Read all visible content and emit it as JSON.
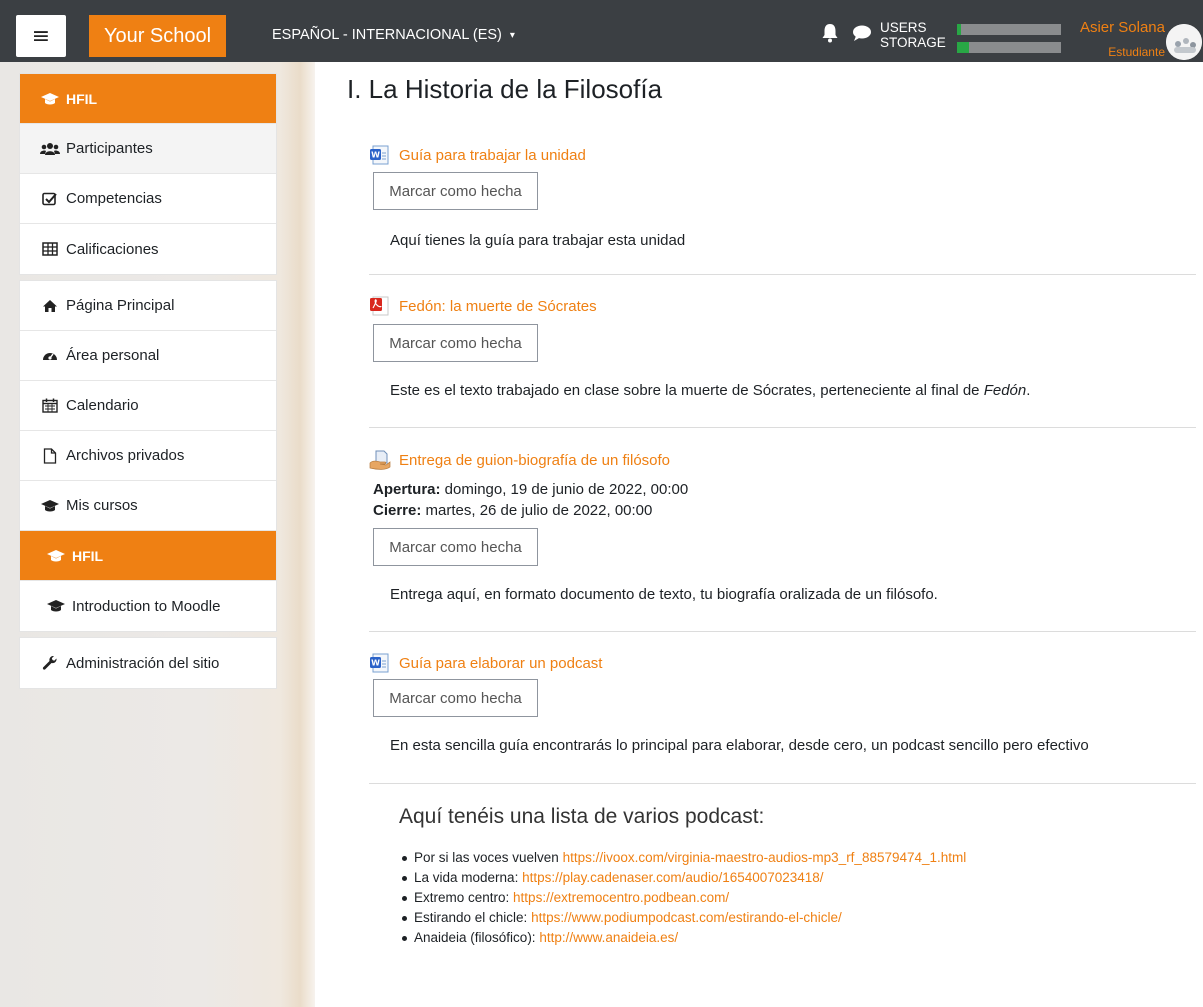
{
  "colors": {
    "accent": "#ef8013",
    "navbar": "#3b3f43",
    "progress": "#28a745"
  },
  "navbar": {
    "menu_icon": "hamburger-icon",
    "menu_glyph": "≡",
    "brand": "Your School",
    "language": "ESPAÑOL - INTERNACIONAL (ES)",
    "language_caret": "▾",
    "users_label": "USERS",
    "storage_label": "STORAGE",
    "users_usage_percent": 4,
    "storage_usage_percent": 12,
    "user_name": "Asier Solana",
    "user_role": "Estudiante"
  },
  "sidebar": {
    "course_group": [
      {
        "label": "HFIL",
        "icon": "graduation-cap-icon"
      },
      {
        "label": "Participantes",
        "icon": "users-icon"
      },
      {
        "label": "Competencias",
        "icon": "checkbox-icon"
      },
      {
        "label": "Calificaciones",
        "icon": "table-icon"
      }
    ],
    "site_group": [
      {
        "label": "Página Principal",
        "icon": "home-icon"
      },
      {
        "label": "Área personal",
        "icon": "dashboard-icon"
      },
      {
        "label": "Calendario",
        "icon": "calendar-icon"
      },
      {
        "label": "Archivos privados",
        "icon": "file-icon"
      },
      {
        "label": "Mis cursos",
        "icon": "graduation-cap-icon"
      },
      {
        "label": "HFIL",
        "icon": "graduation-cap-icon"
      },
      {
        "label": "Introduction to Moodle",
        "icon": "graduation-cap-icon"
      }
    ],
    "admin": {
      "label": "Administración del sitio",
      "icon": "wrench-icon"
    }
  },
  "main": {
    "section_title": "I. La Historia de la Filosofía",
    "mark_done_label": "Marcar como hecha",
    "activities": [
      {
        "title": "Guía para trabajar la unidad",
        "icon": "word-document-icon",
        "description": "Aquí tienes la guía para trabajar esta unidad"
      },
      {
        "title": "Fedón: la muerte de Sócrates",
        "icon": "pdf-document-icon",
        "description": "Este es el texto trabajado en clase sobre la muerte de Sócrates, perteneciente al final de ",
        "description_italic": "Fedón",
        "description_end": "."
      },
      {
        "title": "Entrega de guion-biografía de un filósofo",
        "icon": "assignment-icon",
        "opening_label": "Apertura:",
        "opening_value": " domingo, 19 de junio de 2022, 00:00",
        "closing_label": "Cierre:",
        "closing_value": " martes, 26 de julio de 2022, 00:00",
        "description": "Entrega aquí, en formato documento de texto, tu biografía oralizada de un filósofo."
      },
      {
        "title": "Guía para elaborar un podcast",
        "icon": "word-document-icon",
        "description": "En esta sencilla guía encontrarás lo principal para elaborar, desde cero, un podcast sencillo pero efectivo"
      }
    ],
    "podcast_heading": "Aquí tenéis una lista de varios podcast:",
    "podcasts": [
      {
        "name": "Por si las voces vuelven ",
        "url": "https://ivoox.com/virginia-maestro-audios-mp3_rf_88579474_1.html"
      },
      {
        "name": "La vida moderna: ",
        "url": "https://play.cadenaser.com/audio/1654007023418/"
      },
      {
        "name": "Extremo centro: ",
        "url": "https://extremocentro.podbean.com/"
      },
      {
        "name": "Estirando el chicle: ",
        "url": "https://www.podiumpodcast.com/estirando-el-chicle/"
      },
      {
        "name": "Anaideia (filosófico): ",
        "url": "http://www.anaideia.es/"
      }
    ]
  }
}
